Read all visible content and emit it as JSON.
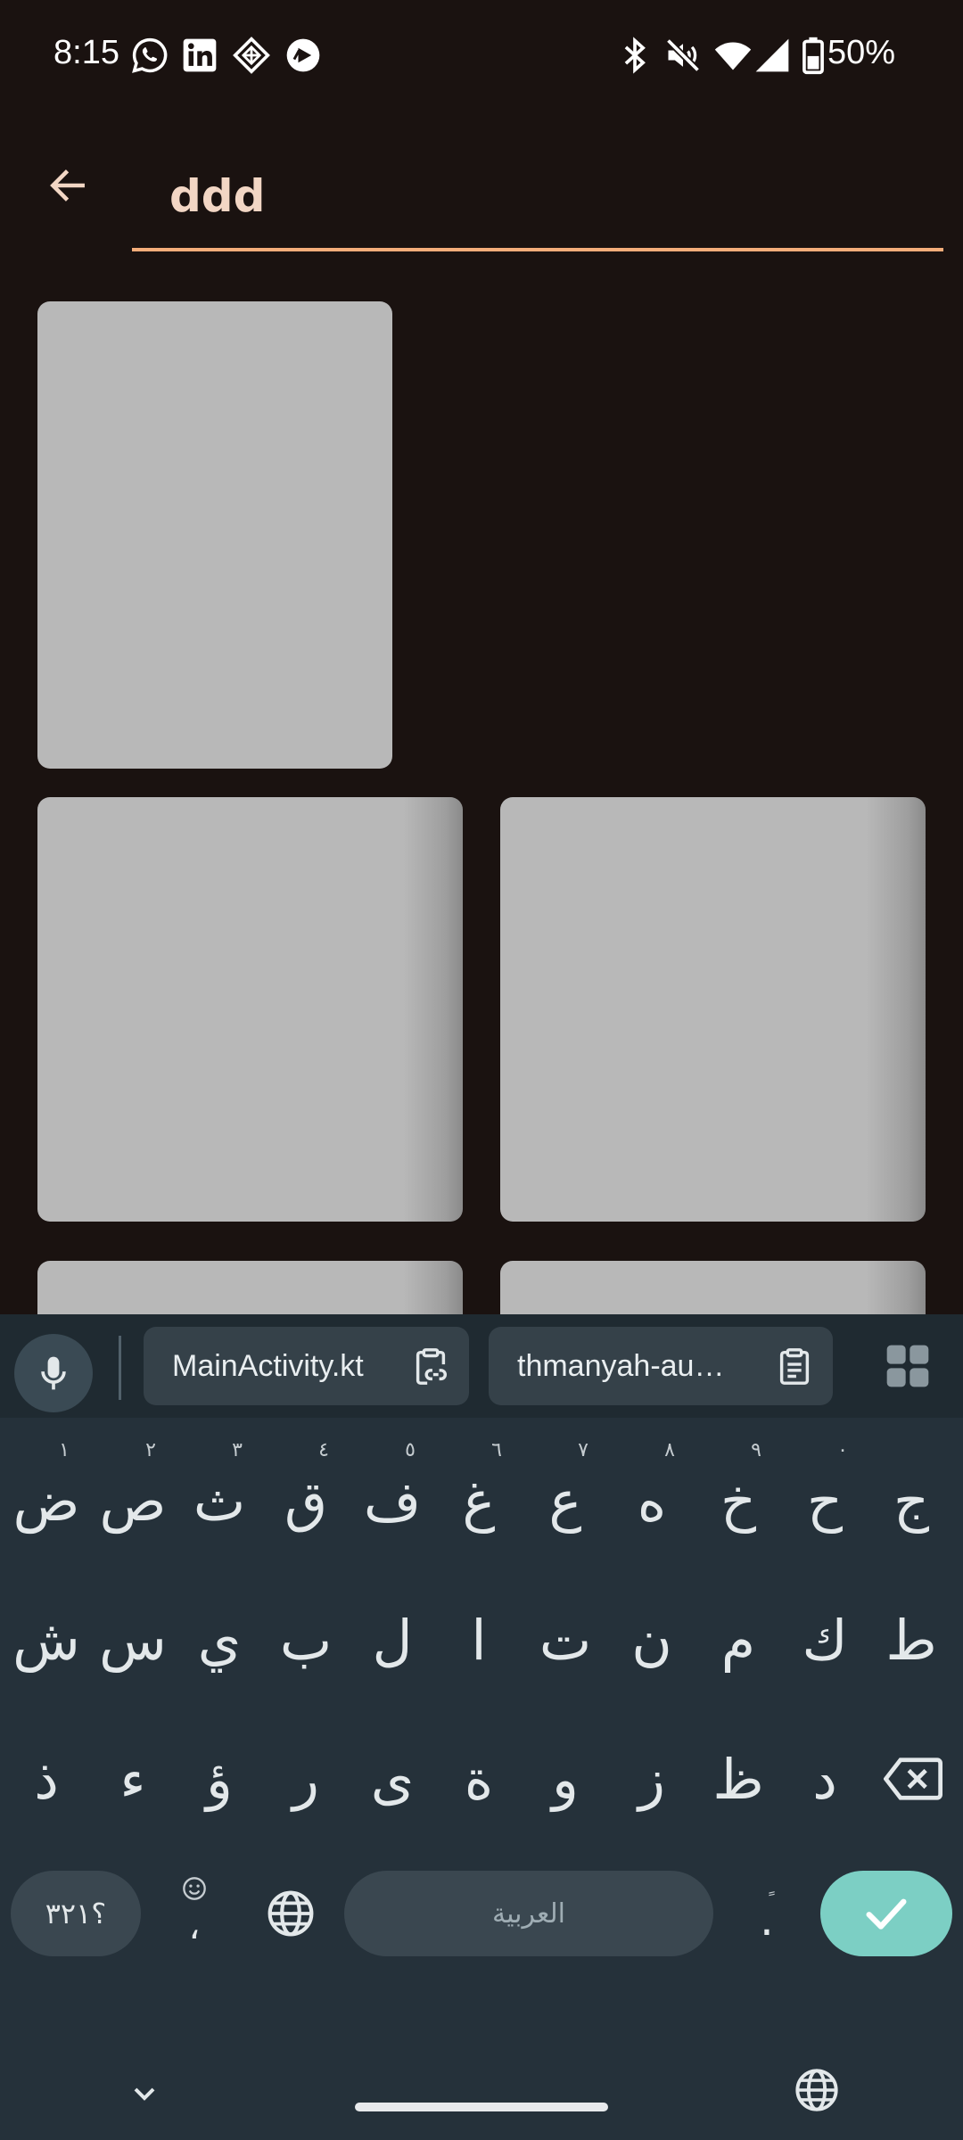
{
  "status_bar": {
    "time": "8:15",
    "battery": "50%",
    "left_icons": [
      "whatsapp-icon",
      "linkedin-icon",
      "app-grid-icon",
      "play-icon"
    ],
    "right_icons": [
      "bluetooth-icon",
      "mute-icon",
      "wifi-icon",
      "signal-icon",
      "battery-icon"
    ]
  },
  "search": {
    "query": "ddd",
    "back_icon": "arrow-left-icon",
    "accent_color": "#f4ad7a"
  },
  "results": {
    "tile_color": "#b8b8b8",
    "tile_count": 5
  },
  "keyboard": {
    "suggestions": [
      {
        "label": "MainActivity.kt",
        "icon": "clipboard-link-icon"
      },
      {
        "label": "thmanyah-au…",
        "icon": "clipboard-icon"
      }
    ],
    "row1": [
      {
        "char": "ض",
        "hint": "١"
      },
      {
        "char": "ص",
        "hint": "٢"
      },
      {
        "char": "ث",
        "hint": "٣"
      },
      {
        "char": "ق",
        "hint": "٤"
      },
      {
        "char": "ف",
        "hint": "٥"
      },
      {
        "char": "غ",
        "hint": "٦"
      },
      {
        "char": "ع",
        "hint": "٧"
      },
      {
        "char": "ه",
        "hint": "٨"
      },
      {
        "char": "خ",
        "hint": "٩"
      },
      {
        "char": "ح",
        "hint": "٠"
      },
      {
        "char": "ج",
        "hint": ""
      }
    ],
    "row2": [
      "ش",
      "س",
      "ي",
      "ب",
      "ل",
      "ا",
      "ت",
      "ن",
      "م",
      "ك",
      "ط"
    ],
    "row3": [
      "ذ",
      "ء",
      "ؤ",
      "ر",
      "ى",
      "ة",
      "و",
      "ز",
      "ظ",
      "د"
    ],
    "numbers_key": "؟٣٢١",
    "comma_key": "،",
    "period_key": ".",
    "space_label": "العربية",
    "enter_color": "#7ccfc4"
  }
}
